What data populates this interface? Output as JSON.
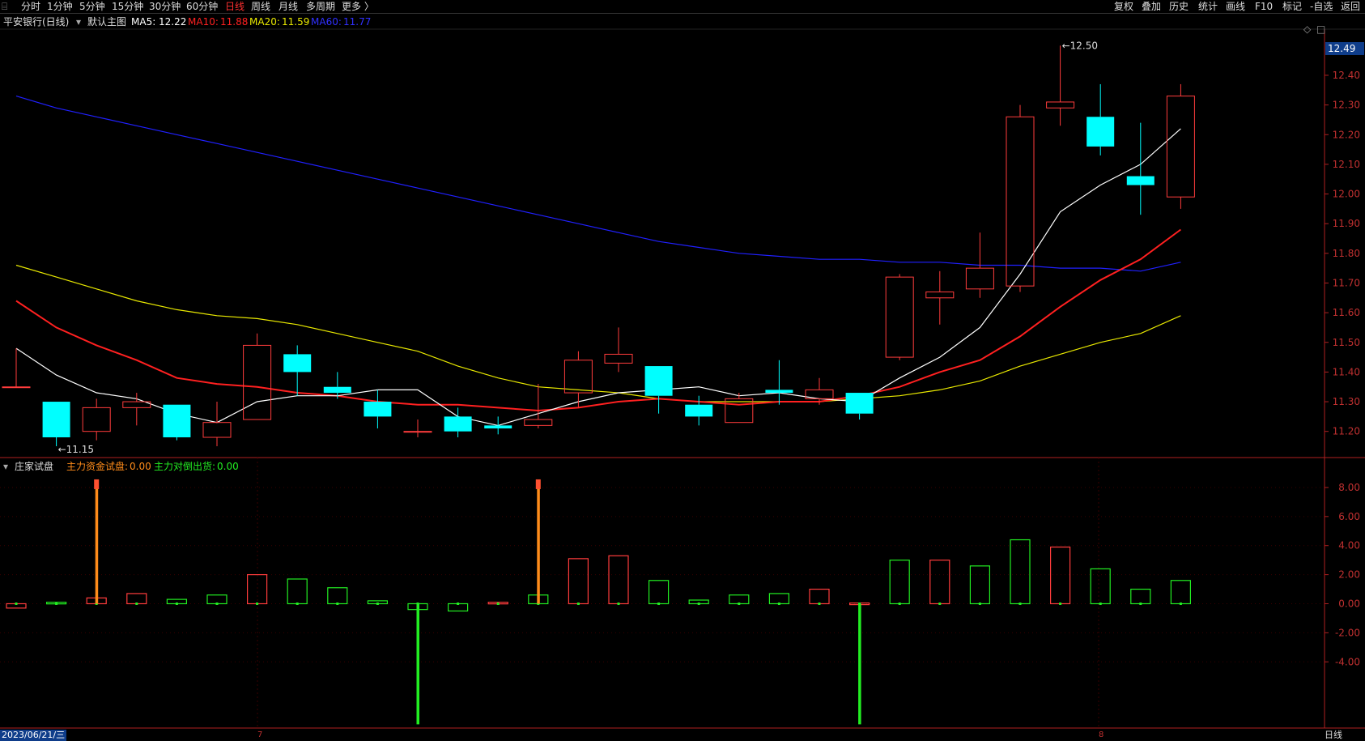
{
  "toolbar": {
    "left": [
      "分时",
      "1分钟",
      "5分钟",
      "15分钟",
      "30分钟",
      "60分钟",
      "日线",
      "周线",
      "月线",
      "多周期",
      "更多 〉"
    ],
    "active": "日线",
    "right": [
      "复权",
      "叠加",
      "历史",
      "统计",
      "画线",
      "F10",
      "标记",
      "-自选",
      "返回"
    ]
  },
  "header": {
    "stock": "平安银行(日线)",
    "main": "默认主图",
    "ma5_label": "MA5:",
    "ma5": "12.22",
    "ma10_label": "MA10:",
    "ma10": "11.88",
    "ma20_label": "MA20:",
    "ma20": "11.59",
    "ma60_label": "MA60:",
    "ma60": "11.77"
  },
  "sub_header": {
    "name": "庄家试盘",
    "s1_label": "主力资金试盘:",
    "s1": "0.00",
    "s2_label": "主力对倒出货:",
    "s2": "0.00"
  },
  "colors": {
    "up": "#ff3c3c",
    "down": "#00ffff",
    "ma5": "#ffffff",
    "ma10": "#ff2020",
    "ma20": "#e8e800",
    "ma60": "#2020ff",
    "orange": "#ff8c1a",
    "green": "#22ee22",
    "axis": "#b02020"
  },
  "bottom": {
    "date": "2023/06/21/三",
    "m1": "7",
    "m2": "8",
    "period": "日线"
  },
  "price_current": "12.49",
  "chart_data": [
    {
      "type": "candlestick",
      "ylim": [
        11.12,
        12.55
      ],
      "y_ticks": [
        "12.40",
        "12.30",
        "12.20",
        "12.10",
        "12.00",
        "11.90",
        "11.80",
        "11.70",
        "11.60",
        "11.50",
        "11.40",
        "11.30",
        "11.20"
      ],
      "annotations": [
        {
          "text": "12.50",
          "value": 12.5,
          "index": 26
        },
        {
          "text": "11.15",
          "value": 11.15,
          "index": 1
        }
      ],
      "candles": [
        {
          "o": 11.35,
          "c": 11.35,
          "h": 11.48,
          "l": 11.35
        },
        {
          "o": 11.3,
          "c": 11.18,
          "h": 11.3,
          "l": 11.15
        },
        {
          "o": 11.2,
          "c": 11.28,
          "h": 11.31,
          "l": 11.17
        },
        {
          "o": 11.28,
          "c": 11.3,
          "h": 11.33,
          "l": 11.22
        },
        {
          "o": 11.29,
          "c": 11.18,
          "h": 11.29,
          "l": 11.17
        },
        {
          "o": 11.18,
          "c": 11.23,
          "h": 11.3,
          "l": 11.15
        },
        {
          "o": 11.24,
          "c": 11.49,
          "h": 11.53,
          "l": 11.24
        },
        {
          "o": 11.46,
          "c": 11.4,
          "h": 11.49,
          "l": 11.32
        },
        {
          "o": 11.35,
          "c": 11.33,
          "h": 11.4,
          "l": 11.31
        },
        {
          "o": 11.3,
          "c": 11.25,
          "h": 11.34,
          "l": 11.21
        },
        {
          "o": 11.2,
          "c": 11.2,
          "h": 11.24,
          "l": 11.18
        },
        {
          "o": 11.25,
          "c": 11.2,
          "h": 11.28,
          "l": 11.18
        },
        {
          "o": 11.22,
          "c": 11.21,
          "h": 11.25,
          "l": 11.19
        },
        {
          "o": 11.22,
          "c": 11.24,
          "h": 11.36,
          "l": 11.21
        },
        {
          "o": 11.33,
          "c": 11.44,
          "h": 11.47,
          "l": 11.28
        },
        {
          "o": 11.43,
          "c": 11.46,
          "h": 11.55,
          "l": 11.4
        },
        {
          "o": 11.42,
          "c": 11.32,
          "h": 11.42,
          "l": 11.26
        },
        {
          "o": 11.29,
          "c": 11.25,
          "h": 11.32,
          "l": 11.22
        },
        {
          "o": 11.23,
          "c": 11.31,
          "h": 11.33,
          "l": 11.23
        },
        {
          "o": 11.34,
          "c": 11.33,
          "h": 11.44,
          "l": 11.29
        },
        {
          "o": 11.31,
          "c": 11.34,
          "h": 11.38,
          "l": 11.29
        },
        {
          "o": 11.33,
          "c": 11.26,
          "h": 11.33,
          "l": 11.24
        },
        {
          "o": 11.45,
          "c": 11.72,
          "h": 11.73,
          "l": 11.44
        },
        {
          "o": 11.65,
          "c": 11.67,
          "h": 11.74,
          "l": 11.56
        },
        {
          "o": 11.68,
          "c": 11.75,
          "h": 11.87,
          "l": 11.65
        },
        {
          "o": 11.69,
          "c": 12.26,
          "h": 12.3,
          "l": 11.67
        },
        {
          "o": 12.29,
          "c": 12.31,
          "h": 12.5,
          "l": 12.23
        },
        {
          "o": 12.26,
          "c": 12.16,
          "h": 12.37,
          "l": 12.13
        },
        {
          "o": 12.06,
          "c": 12.03,
          "h": 12.24,
          "l": 11.93
        },
        {
          "o": 11.99,
          "c": 12.33,
          "h": 12.37,
          "l": 11.95
        }
      ],
      "ma5": [
        11.48,
        11.39,
        11.33,
        11.31,
        11.26,
        11.23,
        11.3,
        11.32,
        11.32,
        11.34,
        11.34,
        11.25,
        11.22,
        11.26,
        11.3,
        11.33,
        11.34,
        11.35,
        11.32,
        11.33,
        11.31,
        11.3,
        11.38,
        11.45,
        11.55,
        11.73,
        11.94,
        12.03,
        12.1,
        12.22
      ],
      "ma10": [
        11.64,
        11.55,
        11.49,
        11.44,
        11.38,
        11.36,
        11.35,
        11.33,
        11.32,
        11.3,
        11.29,
        11.29,
        11.28,
        11.27,
        11.28,
        11.3,
        11.31,
        11.3,
        11.29,
        11.3,
        11.3,
        11.32,
        11.35,
        11.4,
        11.44,
        11.52,
        11.62,
        11.71,
        11.78,
        11.88
      ],
      "ma20": [
        11.76,
        11.72,
        11.68,
        11.64,
        11.61,
        11.59,
        11.58,
        11.56,
        11.53,
        11.5,
        11.47,
        11.42,
        11.38,
        11.35,
        11.34,
        11.33,
        11.31,
        11.3,
        11.3,
        11.3,
        11.3,
        11.31,
        11.32,
        11.34,
        11.37,
        11.42,
        11.46,
        11.5,
        11.53,
        11.59
      ],
      "ma60": [
        12.33,
        12.29,
        12.26,
        12.23,
        12.2,
        12.17,
        12.14,
        12.11,
        12.08,
        12.05,
        12.02,
        11.99,
        11.96,
        11.93,
        11.9,
        11.87,
        11.84,
        11.82,
        11.8,
        11.79,
        11.78,
        11.78,
        11.77,
        11.77,
        11.76,
        11.76,
        11.75,
        11.75,
        11.74,
        11.77
      ]
    },
    {
      "type": "bar",
      "title": "庄家试盘",
      "ylim": [
        -8.5,
        9.0
      ],
      "y_ticks": [
        "8.00",
        "6.00",
        "4.00",
        "2.00",
        "0.00",
        "-2.00",
        "-4.00"
      ],
      "values": [
        -0.3,
        0.1,
        0.4,
        0.7,
        0.3,
        0.6,
        2.0,
        1.7,
        1.1,
        0.2,
        -0.4,
        -0.5,
        0.1,
        0.6,
        3.1,
        3.3,
        1.6,
        0.25,
        0.6,
        0.7,
        1.0,
        0.05,
        3.0,
        3.0,
        2.6,
        4.4,
        3.9,
        2.4,
        1.0,
        1.6
      ],
      "spikes": [
        {
          "index": 2,
          "value": 8.0,
          "color": "orange"
        },
        {
          "index": 13,
          "value": 8.0,
          "color": "orange"
        },
        {
          "index": 10,
          "value": -8.3,
          "color": "green"
        },
        {
          "index": 21,
          "value": -8.3,
          "color": "green"
        }
      ]
    }
  ]
}
